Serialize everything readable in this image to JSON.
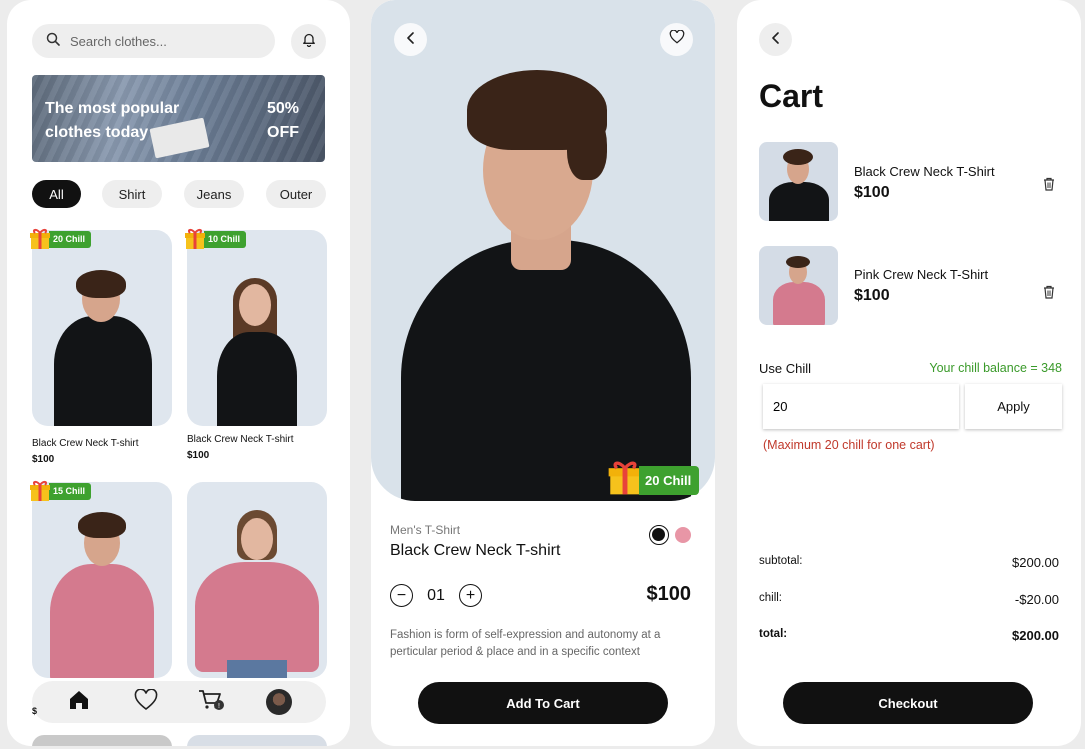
{
  "browse": {
    "search_placeholder": "Search clothes...",
    "banner": {
      "line1": "The most popular",
      "line2": "clothes today",
      "discount_line1": "50%",
      "discount_line2": "OFF"
    },
    "categories": [
      "All",
      "Shirt",
      "Jeans",
      "Outer"
    ],
    "products": [
      {
        "name": "Black Crew Neck T-shirt",
        "price": "$100",
        "chill": "20 Chill",
        "shirt_color": "#121416"
      },
      {
        "name": "Black Crew Neck T-shirt",
        "price": "$100",
        "chill": "10 Chill",
        "shirt_color": "#121416"
      },
      {
        "name": "",
        "price": "",
        "chill": "15 Chill",
        "shirt_color": "#d47a8e"
      },
      {
        "name": "",
        "price": "",
        "chill": "",
        "shirt_color": "#d47a8e"
      }
    ],
    "nav": [
      "home-icon",
      "heart-icon",
      "cart-icon",
      "avatar"
    ]
  },
  "detail": {
    "chill_badge": "20 Chill",
    "category": "Men's T-Shirt",
    "title": "Black Crew Neck T-shirt",
    "colors": [
      "#111111",
      "#e896a6"
    ],
    "quantity": "01",
    "price": "$100",
    "description": "Fashion is form of self-expression and autonomy at a perticular period & place and in a specific context",
    "add_to_cart": "Add To Cart"
  },
  "cart": {
    "title": "Cart",
    "items": [
      {
        "name": "Black Crew Neck T-Shirt",
        "price": "$100",
        "shirt_color": "#121416"
      },
      {
        "name": "Pink Crew Neck T-Shirt",
        "price": "$100",
        "shirt_color": "#d47a8e"
      }
    ],
    "use_chill_label": "Use Chill",
    "balance": "Your chill balance = 348",
    "chill_value": "20",
    "apply_label": "Apply",
    "max_note": "(Maximum 20 chill for one cart)",
    "subtotal_label": "subtotal:",
    "subtotal_value": "$200.00",
    "chill_label": "chill:",
    "chill_discount": "-$20.00",
    "total_label": "total:",
    "total_value": "$200.00",
    "checkout": "Checkout"
  },
  "colors": {
    "accent_green": "#3ea12f",
    "error_red": "#c0392b",
    "balance_green": "#3a9a2a"
  }
}
